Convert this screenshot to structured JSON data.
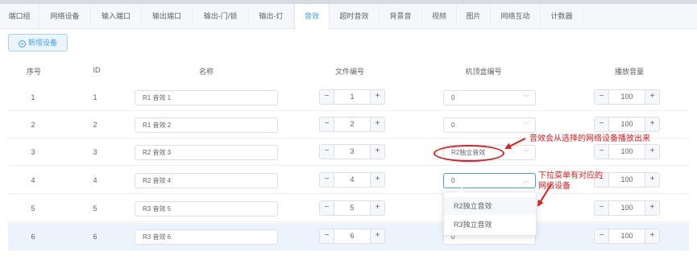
{
  "tabs": [
    {
      "label": "端口组",
      "active": false
    },
    {
      "label": "网络设备",
      "active": false
    },
    {
      "label": "输入端口",
      "active": false
    },
    {
      "label": "输出端口",
      "active": false
    },
    {
      "label": "输出-门/锁",
      "active": false
    },
    {
      "label": "输出-灯",
      "active": false
    },
    {
      "label": "音效",
      "active": true
    },
    {
      "label": "超时音效",
      "active": false
    },
    {
      "label": "背景音",
      "active": false
    },
    {
      "label": "视频",
      "active": false
    },
    {
      "label": "图片",
      "active": false
    },
    {
      "label": "网络互动",
      "active": false
    },
    {
      "label": "计数器",
      "active": false
    }
  ],
  "toolbar": {
    "add_icon": "plus-circle-icon",
    "add_label": "新增设备"
  },
  "table": {
    "headers": [
      "序号",
      "ID",
      "名称",
      "文件编号",
      "机顶盒编号",
      "播放音量"
    ],
    "rows": [
      {
        "index": "1",
        "id": "1",
        "name": "R1 音效 1",
        "file_no": "1",
        "box": "0",
        "volume": "100"
      },
      {
        "index": "2",
        "id": "2",
        "name": "R1 音效 2",
        "file_no": "2",
        "box": "0",
        "volume": "100"
      },
      {
        "index": "3",
        "id": "3",
        "name": "R2 音效 3",
        "file_no": "3",
        "box": "R2独立音效",
        "volume": "100"
      },
      {
        "index": "4",
        "id": "4",
        "name": "R2 音效 4",
        "file_no": "4",
        "box": "0",
        "volume": "100"
      },
      {
        "index": "5",
        "id": "5",
        "name": "R3 音效 5",
        "file_no": "5",
        "box": "",
        "volume": "100"
      },
      {
        "index": "6",
        "id": "6",
        "name": "R3 音效 6",
        "file_no": "6",
        "box": "0",
        "volume": "100"
      }
    ],
    "minus_symbol": "−",
    "plus_symbol": "+"
  },
  "dropdown": {
    "options": [
      "R2独立音效",
      "R3独立音效"
    ]
  },
  "annotations": {
    "note1": "音效会从选择的网络设备播放出来",
    "note2_line1": "下拉菜单有对应的",
    "note2_line2": "网络设备",
    "color": "#e8191c"
  },
  "colors": {
    "accent": "#409eff",
    "highlight_row": "#ecf3fc",
    "annotation": "#e8191c"
  }
}
